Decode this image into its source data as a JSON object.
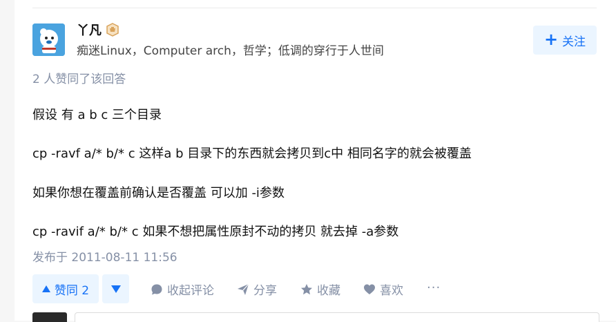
{
  "author": {
    "name": "丫凡",
    "bio": "痴迷Linux，Computer arch，哲学；低调的穿行于人世间",
    "badge_icon": "badge-icon",
    "avatar_color": "#4aa3df"
  },
  "follow": {
    "label": "关注",
    "icon": "plus-icon"
  },
  "upvote_info": "2 人赞同了该回答",
  "content": {
    "paragraphs": [
      "假设 有 a b c 三个目录",
      "cp -ravf a/* b/* c 这样a b 目录下的东西就会拷贝到c中 相同名字的就会被覆盖",
      "如果你想在覆盖前确认是否覆盖 可以加 -i参数",
      "cp -ravif a/* b/* c 如果不想把属性原封不动的拷贝 就去掉 -a参数"
    ]
  },
  "publish_time": "发布于 2011-08-11 11:56",
  "actions": {
    "vote_up_label": "赞同 2",
    "comment_label": "收起评论",
    "share_label": "分享",
    "favorite_label": "收藏",
    "like_label": "喜欢",
    "more_label": "···"
  },
  "colors": {
    "accent": "#1772f6",
    "accent_bg": "#ebf5ff",
    "muted": "#8590a6"
  }
}
